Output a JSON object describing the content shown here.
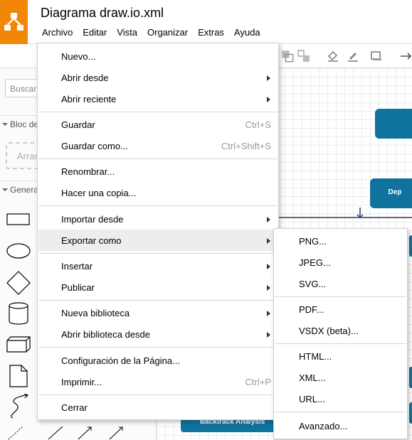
{
  "app": {
    "title": "Diagrama draw.io.xml",
    "brand_color": "#f08705"
  },
  "menubar": [
    "Archivo",
    "Editar",
    "Vista",
    "Organizar",
    "Extras",
    "Ayuda"
  ],
  "sidebar": {
    "search_placeholder": "Buscar",
    "sections": [
      "Bloc de",
      "Genera"
    ],
    "scratchpad_hint": "Arras"
  },
  "canvas": {
    "nodes": [
      {
        "label": ""
      },
      {
        "label": "Dep"
      },
      {
        "label": "Backtrack Analysis"
      }
    ],
    "node_color": "#10739e"
  },
  "file_menu": {
    "items": [
      {
        "label": "Nuevo...",
        "shortcut": "",
        "submenu": false
      },
      {
        "label": "Abrir desde",
        "shortcut": "",
        "submenu": true
      },
      {
        "label": "Abrir reciente",
        "shortcut": "",
        "submenu": true
      },
      {
        "label": "Guardar",
        "shortcut": "Ctrl+S",
        "submenu": false
      },
      {
        "label": "Guardar como...",
        "shortcut": "Ctrl+Shift+S",
        "submenu": false
      },
      {
        "label": "Renombrar...",
        "shortcut": "",
        "submenu": false
      },
      {
        "label": "Hacer una copia...",
        "shortcut": "",
        "submenu": false
      },
      {
        "label": "Importar desde",
        "shortcut": "",
        "submenu": true
      },
      {
        "label": "Exportar como",
        "shortcut": "",
        "submenu": true
      },
      {
        "label": "Insertar",
        "shortcut": "",
        "submenu": true
      },
      {
        "label": "Publicar",
        "shortcut": "",
        "submenu": true
      },
      {
        "label": "Nueva biblioteca",
        "shortcut": "",
        "submenu": true
      },
      {
        "label": "Abrir biblioteca desde",
        "shortcut": "",
        "submenu": true
      },
      {
        "label": "Configuración de la Página...",
        "shortcut": "",
        "submenu": false
      },
      {
        "label": "Imprimir...",
        "shortcut": "Ctrl+P",
        "submenu": false
      },
      {
        "label": "Cerrar",
        "shortcut": "",
        "submenu": false
      }
    ]
  },
  "export_menu": {
    "items": [
      "PNG...",
      "JPEG...",
      "SVG...",
      "PDF...",
      "VSDX (beta)...",
      "HTML...",
      "XML...",
      "URL...",
      "Avanzado..."
    ]
  }
}
